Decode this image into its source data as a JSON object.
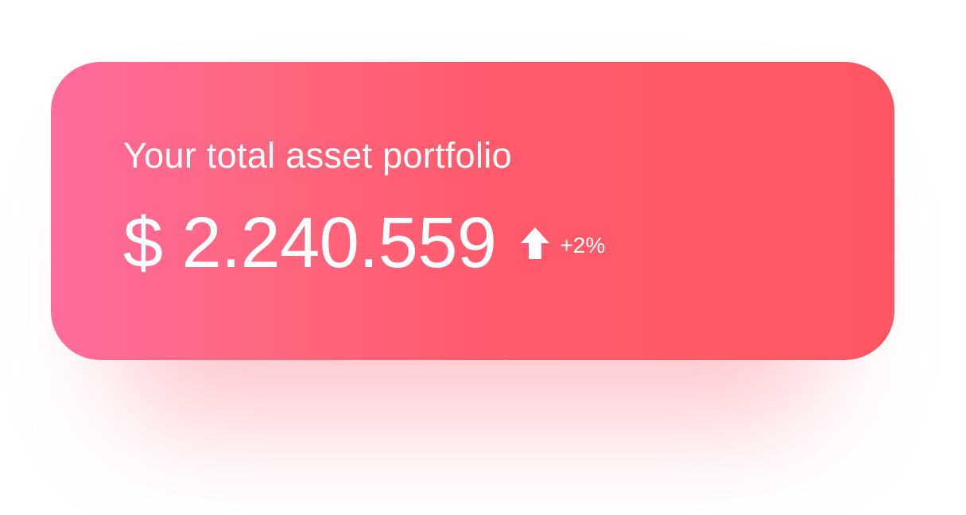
{
  "portfolio": {
    "title": "Your total asset portfolio",
    "currency_symbol": "$",
    "amount": "2.240.559",
    "change": "+2%",
    "trend_icon": "arrow-up-icon"
  },
  "colors": {
    "gradient_start": "#ff6b9c",
    "gradient_end": "#ff5664",
    "text": "#ffffff"
  }
}
